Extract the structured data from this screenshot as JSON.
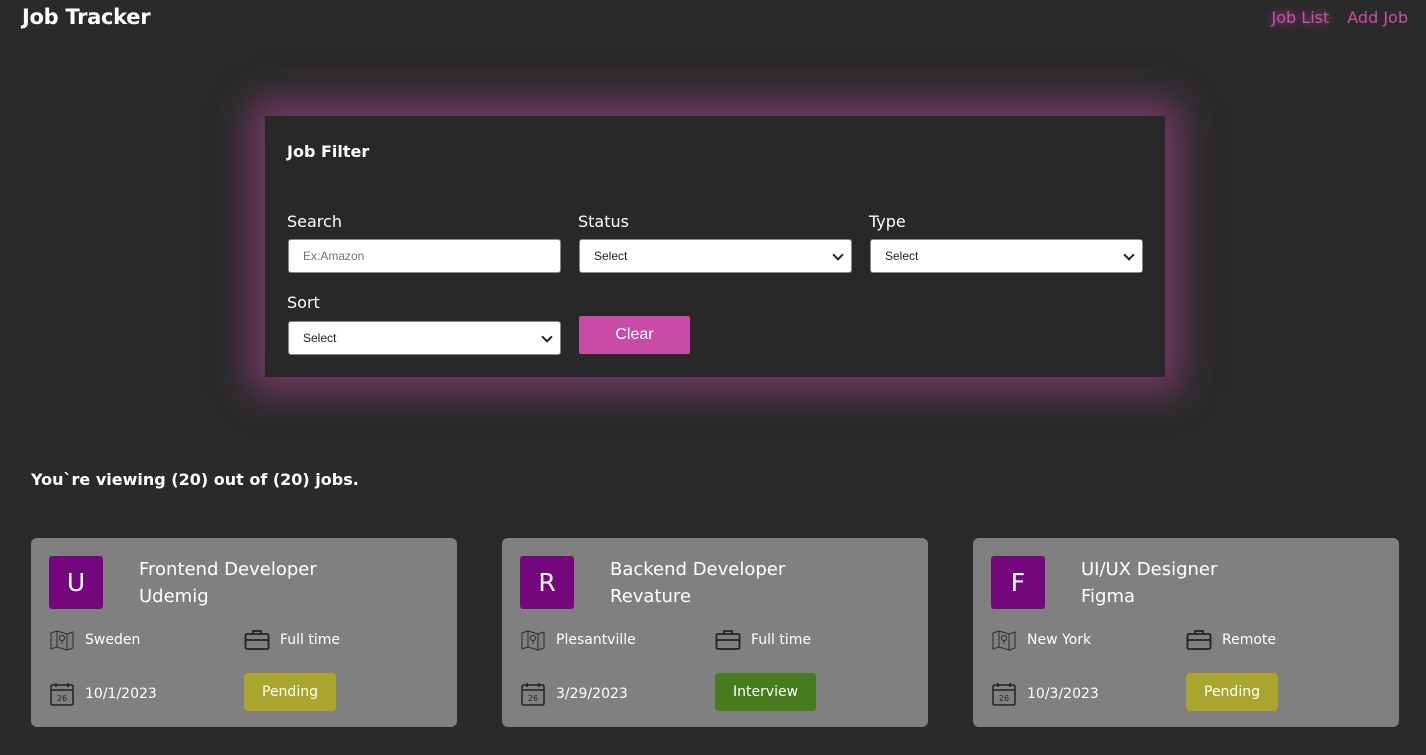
{
  "header": {
    "brand": "Job Tracker",
    "nav": [
      {
        "label": "Job List",
        "active": true
      },
      {
        "label": "Add Job",
        "active": false
      }
    ],
    "accent_color": "#cc4fa9"
  },
  "filter": {
    "title": "Job Filter",
    "search": {
      "label": "Search",
      "placeholder": "Ex:Amazon",
      "value": ""
    },
    "status": {
      "label": "Status",
      "selected": "Select"
    },
    "type": {
      "label": "Type",
      "selected": "Select"
    },
    "sort": {
      "label": "Sort",
      "selected": "Select"
    },
    "clear_label": "Clear"
  },
  "summary": "You`re viewing (20) out of (20) jobs.",
  "jobs": [
    {
      "initial": "U",
      "title": "Frontend Developer",
      "company": "Udemig",
      "location": "Sweden",
      "job_type": "Full time",
      "date": "10/1/2023",
      "status": "Pending",
      "status_color": "#aaa62d",
      "calendar_day": "26"
    },
    {
      "initial": "R",
      "title": "Backend Developer",
      "company": "Revature",
      "location": "Plesantville",
      "job_type": "Full time",
      "date": "3/29/2023",
      "status": "Interview",
      "status_color": "#467c1d",
      "calendar_day": "26"
    },
    {
      "initial": "F",
      "title": "UI/UX Designer",
      "company": "Figma",
      "location": "New York",
      "job_type": "Remote",
      "date": "10/3/2023",
      "status": "Pending",
      "status_color": "#aaa62d",
      "calendar_day": "26"
    }
  ],
  "icons": {
    "location": "map-icon",
    "job_type": "briefcase-icon",
    "date": "calendar-icon",
    "select_arrow": "chevron-down-icon"
  }
}
